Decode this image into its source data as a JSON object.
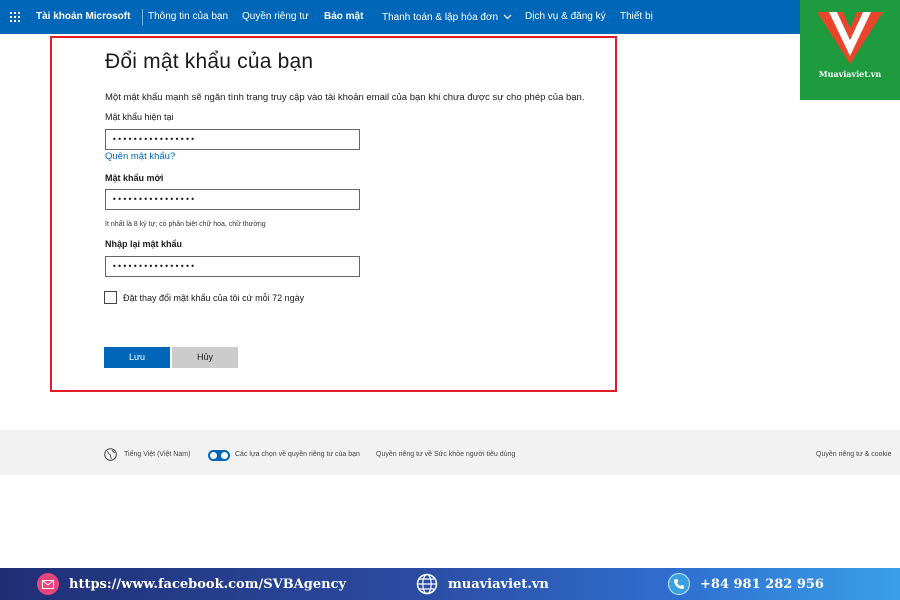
{
  "nav": {
    "brand": "Tài khoản Microsoft",
    "items": [
      {
        "label": "Thông tin của bạn"
      },
      {
        "label": "Quyền riêng tư"
      },
      {
        "label": "Bảo mật"
      },
      {
        "label": "Thanh toán & lập hóa đơn"
      },
      {
        "label": "Dịch vụ & đăng ký"
      },
      {
        "label": "Thiết bị"
      }
    ],
    "active": "Bảo mật"
  },
  "logo": {
    "text": "Muaviaviet.vn",
    "colors": {
      "bg": "#1e9b3f",
      "mark": "#e8452a"
    }
  },
  "form": {
    "title": "Đổi mật khẩu của bạn",
    "intro": "Một mật khẩu mạnh sẽ ngăn tình trạng truy cập vào tài khoản email của bạn khi chưa được sự cho phép của bạn.",
    "current_label": "Mật khẩu hiện tại",
    "current_value": "••••••••••••••••",
    "forgot_link": "Quên mật khẩu?",
    "new_label": "Mật khẩu mới",
    "new_value": "••••••••••••••••",
    "hint": "Ít nhất là 8 ký tự; có phân biệt chữ hoa, chữ thường",
    "confirm_label": "Nhập lại mật khẩu",
    "confirm_value": "••••••••••••••••",
    "checkbox_label": "Đặt thay đổi mật khẩu của tôi cứ mỗi 72 ngày",
    "checkbox_checked": false,
    "save_label": "Lưu",
    "cancel_label": "Hủy"
  },
  "footer": {
    "language": "Tiếng Việt (Việt Nam)",
    "privacy_choices": "Các lựa chọn về quyền riêng tư của bạn",
    "health_privacy": "Quyền riêng tư về Sức khỏe người tiêu dùng",
    "privacy_cookies": "Quyền riêng tư & cookie"
  },
  "banner": {
    "facebook": "https://www.facebook.com/SVBAgency",
    "website": "muaviaviet.vn",
    "phone": "+84 981 282 956"
  },
  "colors": {
    "accent": "#0067b8",
    "highlight": "#e11c24"
  }
}
